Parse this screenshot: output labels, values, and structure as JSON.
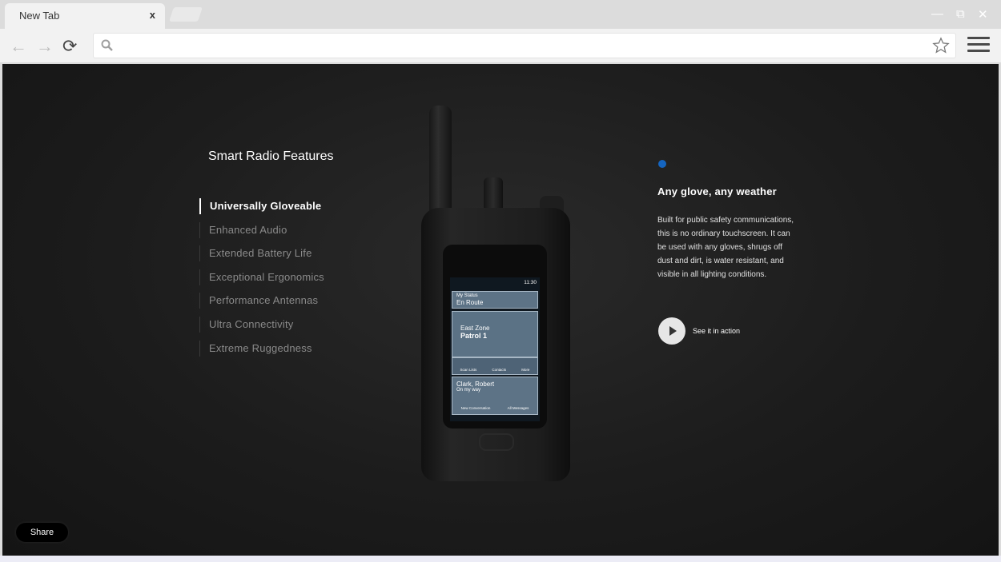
{
  "browser": {
    "tab_title": "New Tab",
    "tab_close": "x",
    "window_controls": {
      "minimize": "—",
      "maximize": "⧉",
      "close": "✕"
    },
    "nav": {
      "back": "←",
      "forward": "→",
      "reload": "⟳"
    },
    "omnibox": {
      "value": "",
      "placeholder": ""
    },
    "icons": {
      "search": "search-icon",
      "star": "star-icon",
      "menu": "menu-icon"
    }
  },
  "page": {
    "features_title": "Smart Radio Features",
    "features": [
      {
        "label": "Universally Gloveable",
        "active": true
      },
      {
        "label": "Enhanced Audio",
        "active": false
      },
      {
        "label": "Extended Battery Life",
        "active": false
      },
      {
        "label": "Exceptional Ergonomics",
        "active": false
      },
      {
        "label": "Performance Antennas",
        "active": false
      },
      {
        "label": "Ultra Connectivity",
        "active": false
      },
      {
        "label": "Extreme Ruggedness",
        "active": false
      }
    ],
    "detail": {
      "title": "Any glove, any weather",
      "body": "Built for public safety communications, this is no ordinary touchscreen. It can be used with any gloves, shrugs off dust and dirt, is water resistant, and visible in all lighting conditions.",
      "cta_label": "See it in action"
    },
    "share_label": "Share",
    "accent_color": "#1565c0"
  },
  "radio_screen": {
    "time": "11:30",
    "my_status_label": "My Status",
    "my_status_value": "En Route",
    "zone": "East Zone",
    "patrol": "Patrol 1",
    "tabs": [
      "Scan Lists",
      "Contacts",
      "More"
    ],
    "contact_name": "Clark, Robert",
    "contact_status": "On my way",
    "actions": [
      "New Conversation",
      "All Messages"
    ]
  }
}
